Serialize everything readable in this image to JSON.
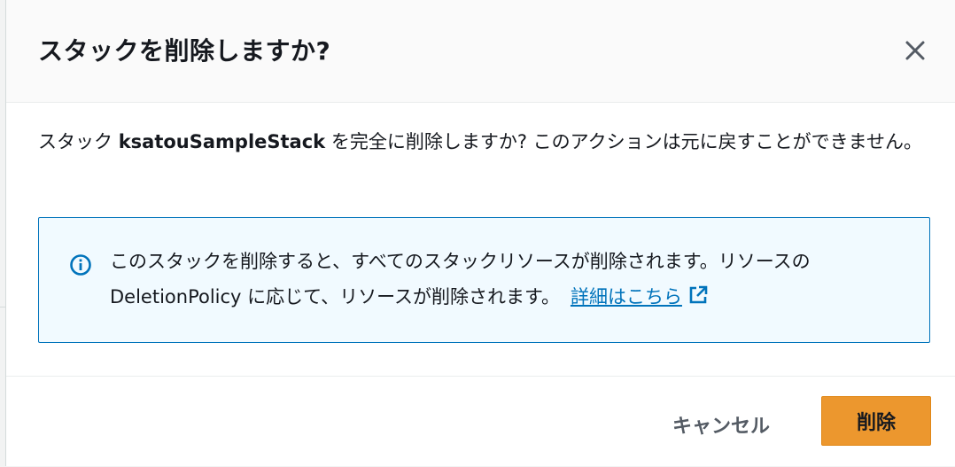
{
  "dialog": {
    "title": "スタックを削除しますか?",
    "close_icon": "close-icon"
  },
  "body": {
    "text_prefix": "スタック ",
    "stack_name": "ksatouSampleStack",
    "text_suffix": " を完全に削除しますか? このアクションは元に戻すことができません。"
  },
  "alert": {
    "icon": "info-icon",
    "message": "このスタックを削除すると、すべてのスタックリソースが削除されます。リソースの DeletionPolicy に応じて、リソースが削除されます。",
    "link_label": "詳細はこちら",
    "link_icon": "external-link-icon"
  },
  "footer": {
    "cancel_label": "キャンセル",
    "delete_label": "削除"
  },
  "colors": {
    "primary_button": "#ec972e",
    "link": "#0073bb",
    "alert_border": "#0073bb",
    "alert_background": "#f1faff"
  }
}
